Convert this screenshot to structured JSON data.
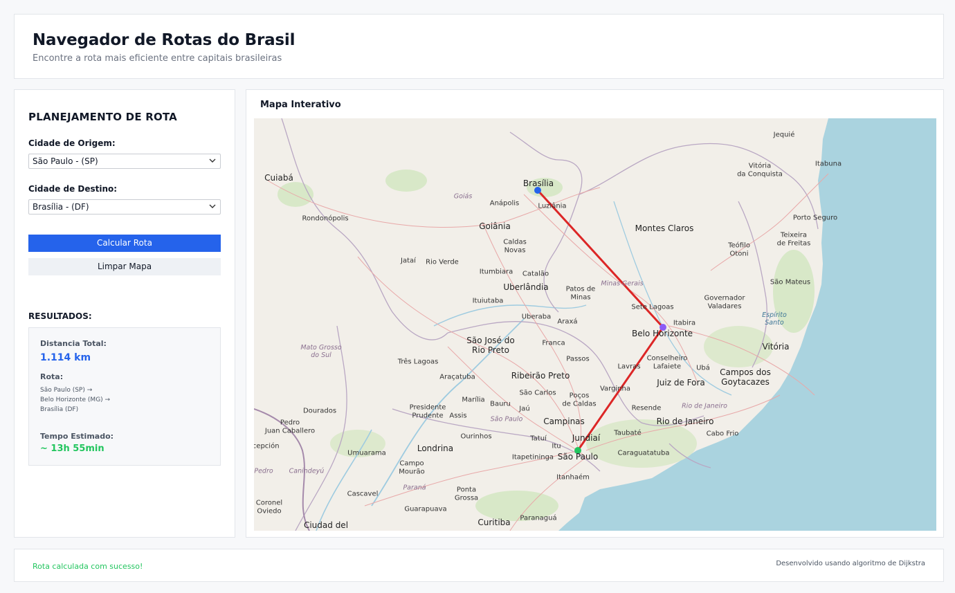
{
  "header": {
    "title": "Navegador de Rotas do Brasil",
    "subtitle": "Encontre a rota mais eficiente entre capitais brasileiras"
  },
  "panel": {
    "title": "PLANEJAMENTO DE ROTA",
    "origin_label": "Cidade de Origem:",
    "origin_value": "São Paulo - (SP)",
    "destination_label": "Cidade de Destino:",
    "destination_value": "Brasília - (DF)",
    "calculate_label": "Calcular Rota",
    "clear_label": "Limpar Mapa",
    "results_title": "RESULTADOS:",
    "distance_label": "Distancia Total:",
    "distance_value": "1.114 km",
    "route_label": "Rota:",
    "route_steps": [
      "São Paulo (SP)  →",
      "Belo Horizonte (MG)  →",
      "Brasília (DF)"
    ],
    "time_label": "Tempo Estimado:",
    "time_value": "~ 13h 55min"
  },
  "map": {
    "title": "Mapa Interativo",
    "route_color": "#dc2626",
    "origin_marker_color": "#22c55e",
    "waypoint_marker_color": "#8b5cf6",
    "destination_marker_color": "#2563eb",
    "ocean_color": "#aad3df",
    "labels": {
      "cuiaba": "Cuiabá",
      "brasilia": "Brasília",
      "luziania": "Luziânia",
      "goias": "Goiás",
      "anapolis": "Anápolis",
      "goiania": "Goiânia",
      "rondonopolis": "Rondonópolis",
      "caldas_novas": "Caldas\nNovas",
      "jatai": "Jataí",
      "rio_verde": "Rio Verde",
      "itumbiara": "Itumbiara",
      "catalao": "Catalão",
      "uberlandia": "Uberlândia",
      "ituiutaba": "Ituiutaba",
      "patos": "Patos de\nMinas",
      "minas_gerais": "Minas Gerais",
      "montes_claros": "Montes Claros",
      "jequie": "Jequié",
      "vitoria_conquista": "Vitória\nda Conquista",
      "itabuna": "Itabuna",
      "porto_seguro": "Porto Seguro",
      "teixeira": "Teixeira\nde Freitas",
      "teofilo": "Teófilo\nOtoni",
      "sao_mateus": "São Mateus",
      "governador": "Governador\nValadares",
      "espirito_santo": "Espírito\nSanto",
      "vitoria": "Vitória",
      "sete_lagoas": "Sete Lagoas",
      "itabira": "Itabira",
      "belo_horizonte": "Belo Horizonte",
      "uberaba": "Uberaba",
      "araxa": "Araxá",
      "mato_grosso_sul": "Mato Grosso\ndo Sul",
      "sjrp": "São José do\nRio Preto",
      "franca": "Franca",
      "passos": "Passos",
      "tres_lagoas": "Três Lagoas",
      "conselheiro": "Conselheiro\nLafaiete",
      "uba": "Ubá",
      "lavras": "Lavras",
      "aracatuba": "Araçatuba",
      "ribeirao": "Ribeirão Preto",
      "juiz_de_fora": "Juiz de Fora",
      "campos": "Campos dos\nGoytacazes",
      "sao_carlos": "São Carlos",
      "varginha": "Varginha",
      "pocos": "Poços\nde Caldas",
      "marilia": "Marília",
      "bauru": "Bauru",
      "presidente": "Presidente\nPrudente",
      "assis": "Assis",
      "jau": "Jaú",
      "sao_paulo_state": "São Paulo",
      "dourados": "Dourados",
      "resende": "Resende",
      "rio_state": "Rio de Janeiro",
      "rio_de_janeiro": "Rio de Janeiro",
      "cabo_frio": "Cabo Frio",
      "campinas": "Campinas",
      "pedro": "Pedro\nJuan Caballero",
      "ourinhos": "Ourinhos",
      "tatui": "Tatuí",
      "itu": "Itu",
      "jundiai": "Jundiaí",
      "taubate": "Taubaté",
      "umuarama": "Umuarama",
      "londrina": "Londrina",
      "itapetininga": "Itapetininga",
      "sao_paulo": "São Paulo",
      "caraguatatuba": "Caraguatatuba",
      "concepcion": "ncepción",
      "campo_mourao": "Campo\nMourão",
      "itanhaem": "Itanhaém",
      "canindeyu": "Canindeyú",
      "pedro_dpt": "Pedro",
      "parana": "Paraná",
      "cascavel": "Cascavel",
      "ponta_grossa": "Ponta\nGrossa",
      "coronel": "Coronel\nOviedo",
      "guarapuava": "Guarapuava",
      "paranagua": "Paranaguá",
      "ciudad": "Ciudad del",
      "curitiba": "Curitiba"
    }
  },
  "footer": {
    "status": "Rota calculada com sucesso!",
    "credit": "Desenvolvido usando algoritmo de Dijkstra"
  }
}
